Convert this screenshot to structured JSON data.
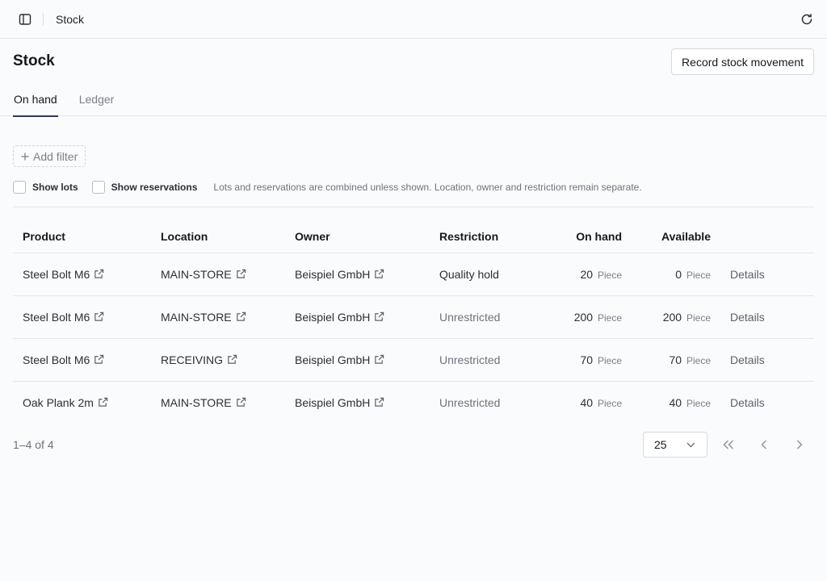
{
  "topbar": {
    "breadcrumb": "Stock"
  },
  "page": {
    "title": "Stock",
    "primary_action": "Record stock movement"
  },
  "tabs": [
    {
      "label": "On hand",
      "active": true
    },
    {
      "label": "Ledger",
      "active": false
    }
  ],
  "filters": {
    "add_filter_label": "Add filter",
    "show_lots_label": "Show lots",
    "show_lots_checked": false,
    "show_reservations_label": "Show reservations",
    "show_reservations_checked": false,
    "hint": "Lots and reservations are combined unless shown. Location, owner and restriction remain separate."
  },
  "table": {
    "columns": [
      "Product",
      "Location",
      "Owner",
      "Restriction",
      "On hand",
      "Available"
    ],
    "rows": [
      {
        "product": "Steel Bolt M6",
        "location": "MAIN-STORE",
        "owner": "Beispiel GmbH",
        "restriction": "Quality hold",
        "on_hand": "20",
        "available": "0",
        "unit": "Piece",
        "action": "Details"
      },
      {
        "product": "Steel Bolt M6",
        "location": "MAIN-STORE",
        "owner": "Beispiel GmbH",
        "restriction": "Unrestricted",
        "on_hand": "200",
        "available": "200",
        "unit": "Piece",
        "action": "Details"
      },
      {
        "product": "Steel Bolt M6",
        "location": "RECEIVING",
        "owner": "Beispiel GmbH",
        "restriction": "Unrestricted",
        "on_hand": "70",
        "available": "70",
        "unit": "Piece",
        "action": "Details"
      },
      {
        "product": "Oak Plank 2m",
        "location": "MAIN-STORE",
        "owner": "Beispiel GmbH",
        "restriction": "Unrestricted",
        "on_hand": "40",
        "available": "40",
        "unit": "Piece",
        "action": "Details"
      }
    ]
  },
  "pagination": {
    "range": "1–4 of 4",
    "page_size": "25"
  },
  "icons": {
    "sidebar_toggle": "sidebar-toggle-icon",
    "refresh": "refresh-icon",
    "plus": "plus-icon",
    "external_link": "external-link-icon",
    "chevron_down": "chevron-down-icon",
    "first_page": "chevrons-left-icon",
    "prev_page": "chevron-left-icon",
    "next_page": "chevron-right-icon"
  },
  "colors": {
    "tab_indicator": "#2f3a56",
    "border": "#e3e5e8",
    "muted_text": "#6d737c"
  }
}
